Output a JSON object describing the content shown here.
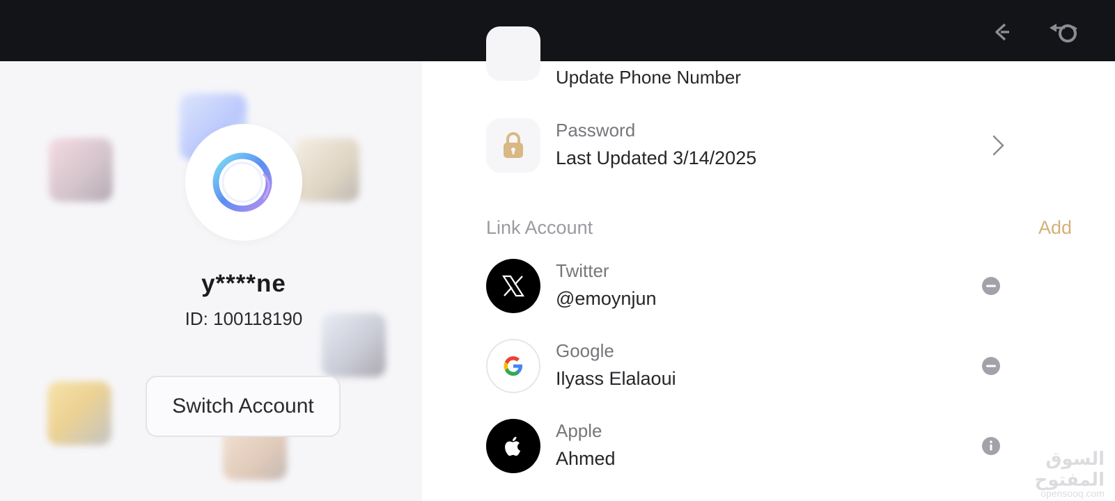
{
  "profile": {
    "username": "y****ne",
    "user_id": "ID: 100118190",
    "switch_label": "Switch Account"
  },
  "security": {
    "phone_title": "Update Phone Number",
    "password_title": "Password",
    "password_value": "Last Updated 3/14/2025"
  },
  "link_account": {
    "label": "Link Account",
    "add_label": "Add",
    "accounts": [
      {
        "provider": "Twitter",
        "value": "@emoynjun",
        "action_icon": "minus-circle-icon"
      },
      {
        "provider": "Google",
        "value": "Ilyass Elalaoui",
        "action_icon": "minus-circle-icon"
      },
      {
        "provider": "Apple",
        "value": "Ahmed",
        "action_icon": "info-circle-icon"
      }
    ]
  },
  "watermark": {
    "arabic": "السوق المفتوح",
    "latin": "opensooq.com"
  },
  "colors": {
    "topbar": "#131418",
    "accent_gold": "#d3b07a",
    "left_panel_bg": "#f6f6f9"
  }
}
